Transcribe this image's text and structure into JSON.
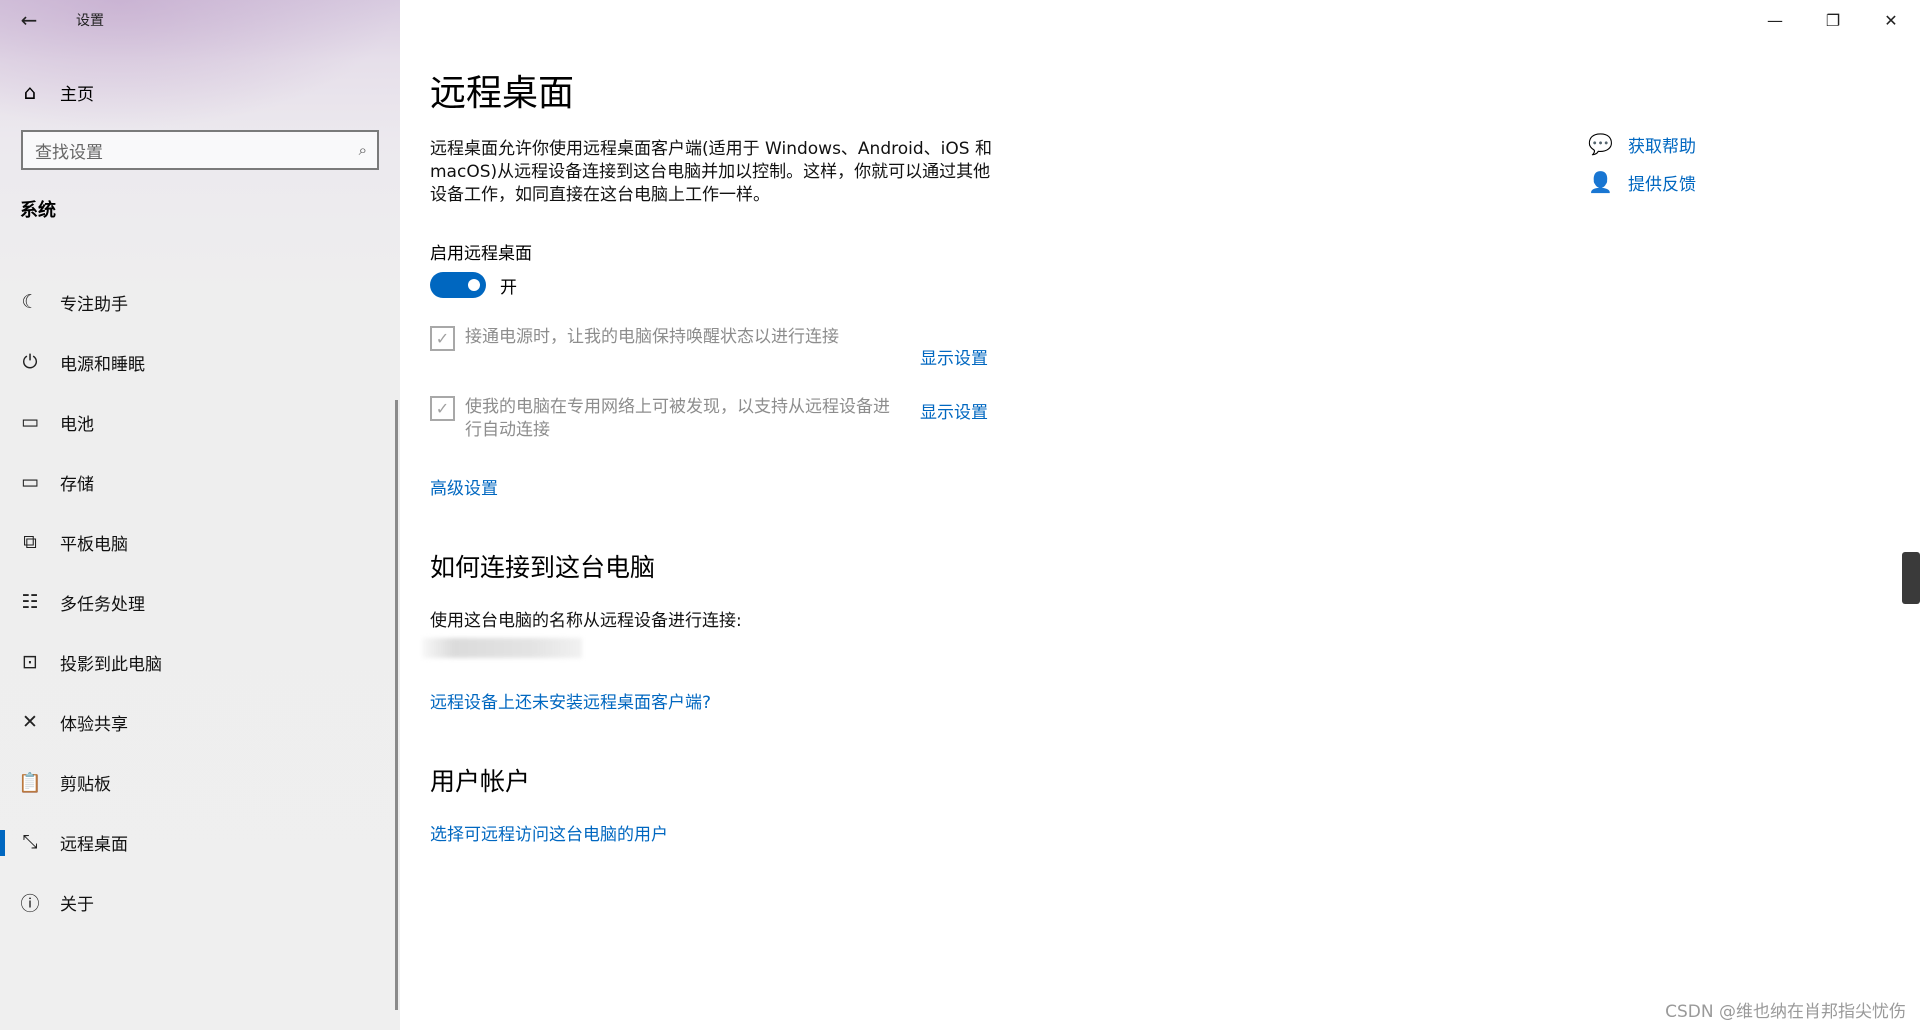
{
  "window": {
    "app_title": "设置",
    "back_icon": "←",
    "minimize_icon": "—",
    "maximize_icon": "❐",
    "close_icon": "✕"
  },
  "sidebar": {
    "home_label": "主页",
    "home_icon": "⌂",
    "search_placeholder": "查找设置",
    "search_icon": "⌕",
    "section_title": "系统",
    "items": [
      {
        "label": "专注助手",
        "icon": "☾"
      },
      {
        "label": "电源和睡眠",
        "icon": "⏻"
      },
      {
        "label": "电池",
        "icon": "▭"
      },
      {
        "label": "存储",
        "icon": "▭"
      },
      {
        "label": "平板电脑",
        "icon": "⧉"
      },
      {
        "label": "多任务处理",
        "icon": "☷"
      },
      {
        "label": "投影到此电脑",
        "icon": "⊡"
      },
      {
        "label": "体验共享",
        "icon": "✕"
      },
      {
        "label": "剪贴板",
        "icon": "📋"
      },
      {
        "label": "远程桌面",
        "icon": "⤡"
      },
      {
        "label": "关于",
        "icon": "ⓘ"
      }
    ],
    "selected_index": 9
  },
  "main": {
    "page_title": "远程桌面",
    "description": "远程桌面允许你使用远程桌面客户端(适用于 Windows、Android、iOS 和 macOS)从远程设备连接到这台电脑并加以控制。这样，你就可以通过其他设备工作，如同直接在这台电脑上工作一样。",
    "enable_label": "启用远程桌面",
    "toggle_state": "开",
    "toggle_on": true,
    "option1_text": "接通电源时，让我的电脑保持唤醒状态以进行连接",
    "option1_link": "显示设置",
    "option2_text": "使我的电脑在专用网络上可被发现，以支持从远程设备进行自动连接",
    "option2_link": "显示设置",
    "advanced_link": "高级设置",
    "connect_heading": "如何连接到这台电脑",
    "use_name_text": "使用这台电脑的名称从远程设备进行连接:",
    "client_link": "远程设备上还未安装远程桌面客户端?",
    "accounts_heading": "用户帐户",
    "users_link": "选择可远程访问这台电脑的用户"
  },
  "help": {
    "get_help": "获取帮助",
    "get_help_icon": "💬",
    "feedback": "提供反馈",
    "feedback_icon": "👤"
  },
  "watermark": "CSDN @维也纳在肖邦指尖忧伤"
}
